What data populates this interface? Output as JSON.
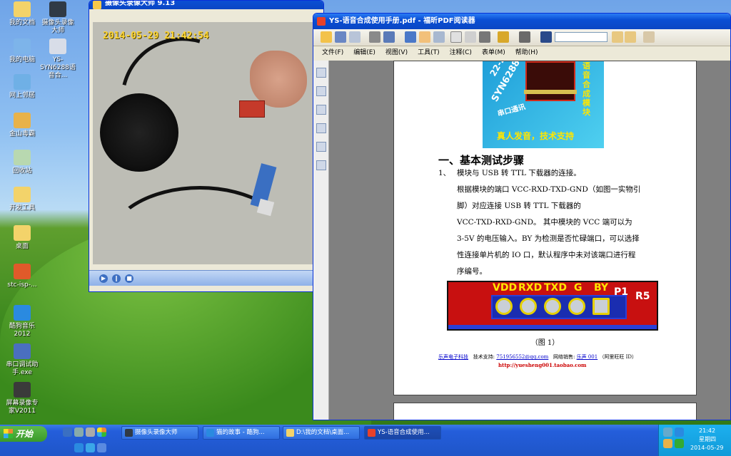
{
  "desktop": {
    "icons": [
      {
        "label": "我的文档",
        "color": "#f3d36a"
      },
      {
        "label": "我的电脑",
        "color": "#7db4ea"
      },
      {
        "label": "网上邻居",
        "color": "#6fb0e6"
      },
      {
        "label": "金山毒霸",
        "color": "#e8b24a"
      },
      {
        "label": "回收站",
        "color": "#b8d8b0"
      },
      {
        "label": "开发工具",
        "color": "#f3d36a"
      },
      {
        "label": "桌面",
        "color": "#f3d36a"
      },
      {
        "label": "stc-isp-...",
        "color": "#e05a2a"
      },
      {
        "label": "酷狗音乐 2012",
        "color": "#2a8ae0"
      },
      {
        "label": "串口调试助手.exe",
        "color": "#4a6fc0"
      },
      {
        "label": "屏幕录像专家V2011",
        "color": "#3a3a3a"
      }
    ],
    "icons_col2": [
      {
        "label": "摄像头录像大师",
        "color": "#303a45"
      },
      {
        "label": "YS-SYN6288语音合...",
        "color": "#d8dde8"
      }
    ]
  },
  "camera_window": {
    "title": "摄像头录像大师 9.13",
    "timestamp": "2014-05-29 21:42:54"
  },
  "pdf_window": {
    "title": "YS-语音合成使用手册.pdf - 福昕PDF阅读器",
    "menu": [
      "文件(F)",
      "编辑(E)",
      "视图(V)",
      "工具(T)",
      "注释(C)",
      "表单(M)",
      "帮助(H)"
    ],
    "page": {
      "logo_text": [
        "SYN6288",
        "语音合成模块",
        "串口通讯",
        "真人发音，技术支持",
        "22-2"
      ],
      "section_heading": "一、基本测试步骤",
      "item_number": "1、",
      "item_title": "模块与 USB 转 TTL 下载器的连接。",
      "body_lines": [
        "根据模块的端口 VCC-RXD-TXD-GND（如图一实物引",
        "脚）对应连接 USB 转 TTL 下载器的",
        "VCC-TXD-RXD-GND。 其中模块的 VCC 端可以为",
        "3-5V 的电压输入。BY 为检测是否忙碌端口，可以选择",
        "性连接单片机的 IO 口，默认程序中未对该端口进行程",
        "序编号。"
      ],
      "pcb_labels": [
        "VDD",
        "RXD",
        "TXD",
        "G",
        "BY",
        "P1",
        "R5"
      ],
      "caption": "（图 1）",
      "footer_company": "乐声电子科技",
      "footer_support_label": "技术支持:",
      "footer_support_email": "751956552@qq.com",
      "footer_store_label": "网络销售:",
      "footer_store_name": "乐声 001",
      "footer_store_note": "（阿里旺旺 ID）",
      "footer_url": "http://yuesheng001.taobao.com"
    }
  },
  "taskbar": {
    "start_label": "开始",
    "tasks": [
      {
        "label": "摄像头录像大师",
        "color": "#303a45"
      },
      {
        "label": "猫的故事 - 酷狗...",
        "color": "#2a8ae0"
      },
      {
        "label": "D:\\我的文档\\桌面...",
        "color": "#f3d36a"
      },
      {
        "label": "YS-语音合成使用...",
        "color": "#e8412a"
      }
    ],
    "clock_time": "21:42",
    "clock_day": "星期四",
    "clock_date": "2014-05-29"
  }
}
